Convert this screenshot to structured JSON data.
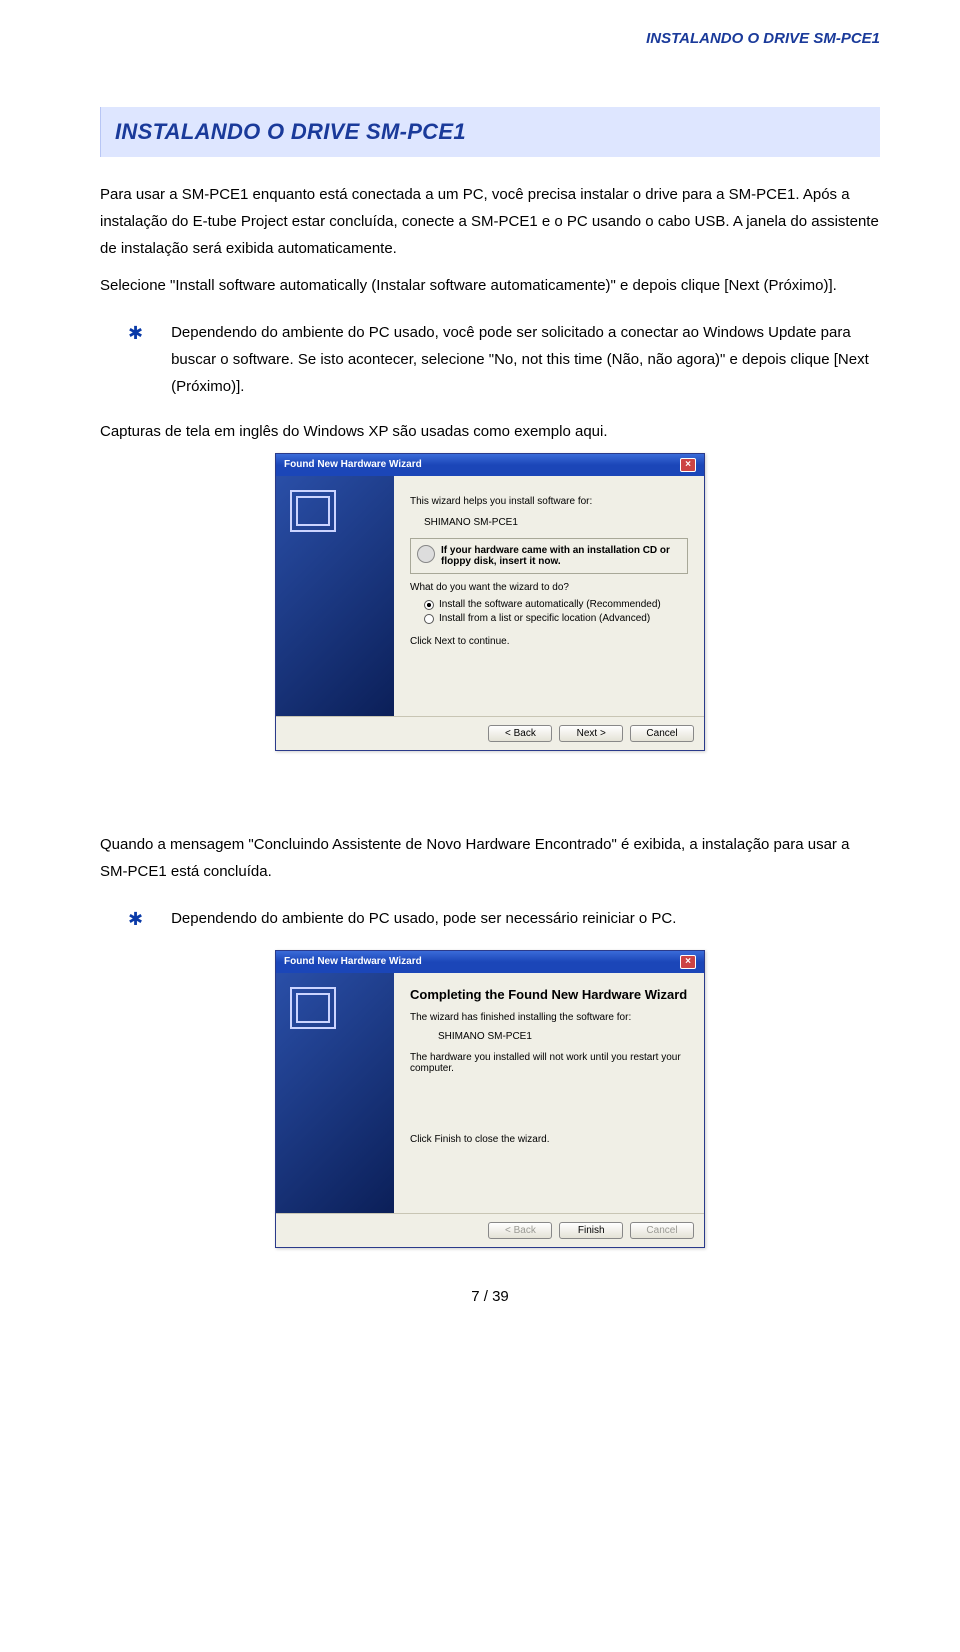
{
  "runningHeader": "INSTALANDO O DRIVE SM-PCE1",
  "sectionTitle": "INSTALANDO O DRIVE SM-PCE1",
  "intro": "Para usar a SM-PCE1 enquanto está conectada a um PC, você precisa instalar o drive para a SM-PCE1. Após a instalação do E-tube Project estar concluída, conecte a SM-PCE1 e o PC usando o cabo USB. A janela do assistente de instalação será exibida automaticamente.",
  "introTail": "Selecione \"Install software automatically (Instalar software automaticamente)\" e depois clique [Next (Próximo)].",
  "note1": "Dependendo do ambiente do PC usado, você pode ser solicitado a conectar ao Windows Update para buscar o software. Se isto acontecer, selecione \"No, not this time (Não, não agora)\" e depois clique [Next (Próximo)].",
  "caption1": "Capturas de tela em inglês do Windows XP são usadas como exemplo aqui.",
  "dialog1": {
    "title": "Found New Hardware Wizard",
    "helpLine": "This wizard helps you install software for:",
    "device": "SHIMANO SM-PCE1",
    "cdHint": "If your hardware came with an installation CD or floppy disk, insert it now.",
    "question": "What do you want the wizard to do?",
    "optAuto": "Install the software automatically (Recommended)",
    "optList": "Install from a list or specific location (Advanced)",
    "cont": "Click Next to continue.",
    "btnBack": "< Back",
    "btnNext": "Next >",
    "btnCancel": "Cancel"
  },
  "conclusion": "Quando a mensagem \"Concluindo Assistente de Novo Hardware Encontrado\" é exibida, a instalação para usar a SM-PCE1 está concluída.",
  "note2": "Dependendo do ambiente do PC usado, pode ser necessário reiniciar o PC.",
  "dialog2": {
    "title": "Found New Hardware Wizard",
    "heading": "Completing the Found New Hardware Wizard",
    "finishedLine": "The wizard has finished installing the software for:",
    "device": "SHIMANO SM-PCE1",
    "restartWarn": "The hardware you installed will not work until you restart your computer.",
    "closeHint": "Click Finish to close the wizard.",
    "btnBack": "< Back",
    "btnFinish": "Finish",
    "btnCancel": "Cancel"
  },
  "pageNumber": "7 / 39"
}
